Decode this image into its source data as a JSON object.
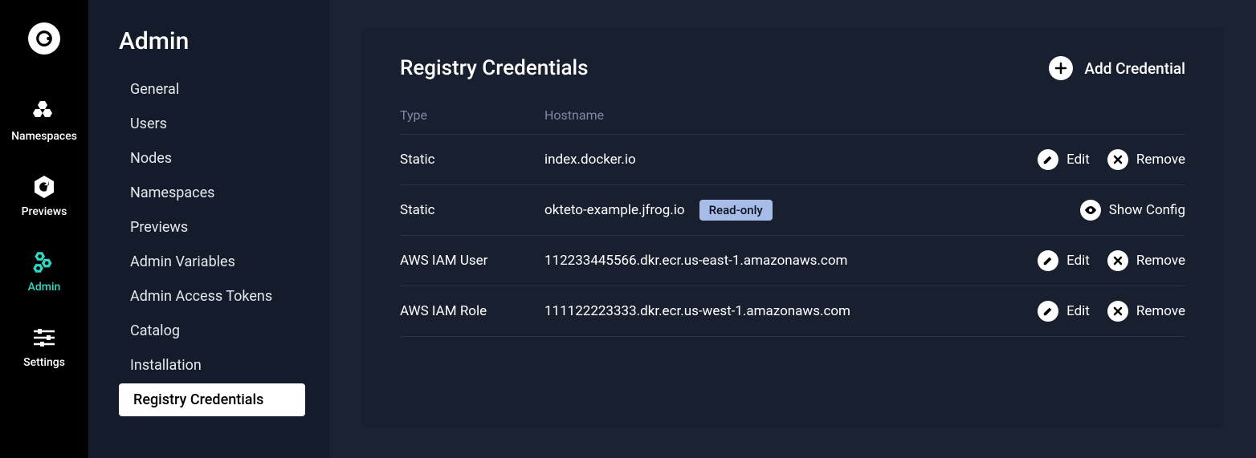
{
  "rail": {
    "items": [
      {
        "label": "Namespaces"
      },
      {
        "label": "Previews"
      },
      {
        "label": "Admin"
      },
      {
        "label": "Settings"
      }
    ]
  },
  "sidebar": {
    "title": "Admin",
    "items": [
      {
        "label": "General"
      },
      {
        "label": "Users"
      },
      {
        "label": "Nodes"
      },
      {
        "label": "Namespaces"
      },
      {
        "label": "Previews"
      },
      {
        "label": "Admin Variables"
      },
      {
        "label": "Admin Access Tokens"
      },
      {
        "label": "Catalog"
      },
      {
        "label": "Installation"
      },
      {
        "label": "Registry Credentials"
      }
    ]
  },
  "panel": {
    "title": "Registry Credentials",
    "add_label": "Add Credential",
    "headers": {
      "type": "Type",
      "hostname": "Hostname"
    },
    "badge_readonly": "Read-only",
    "actions": {
      "edit": "Edit",
      "remove": "Remove",
      "show_config": "Show Config"
    },
    "rows": [
      {
        "type": "Static",
        "hostname": "index.docker.io",
        "readonly": false,
        "mode": "edit"
      },
      {
        "type": "Static",
        "hostname": "okteto-example.jfrog.io",
        "readonly": true,
        "mode": "show"
      },
      {
        "type": "AWS IAM User",
        "hostname": "112233445566.dkr.ecr.us-east-1.amazonaws.com",
        "readonly": false,
        "mode": "edit"
      },
      {
        "type": "AWS IAM Role",
        "hostname": "111122223333.dkr.ecr.us-west-1.amazonaws.com",
        "readonly": false,
        "mode": "edit"
      }
    ]
  }
}
